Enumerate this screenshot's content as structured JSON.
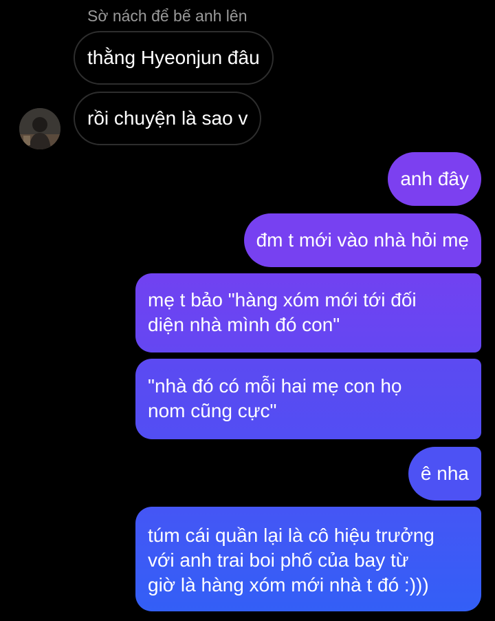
{
  "thread": {
    "sender_name": "Sờ nách để bế anh lên",
    "incoming": [
      "thằng Hyeonjun đâu",
      "rồi chuyện là sao v"
    ],
    "outgoing": [
      "anh đây",
      "đm t mới vào nhà hỏi mẹ",
      "mẹ t bảo \"hàng xóm mới tới đối\ndiện nhà mình đó con\"",
      "\"nhà đó có mỗi hai mẹ con họ\nnom cũng cực\"",
      "ê nha",
      "túm cái quần lại là cô hiệu trưởng\nvới anh trai boi phố của bay từ\ngiờ là hàng xóm mới nhà t đó :)))"
    ]
  },
  "avatar": {
    "icon": "profile-photo"
  },
  "colors": {
    "background": "#000000",
    "incoming_border": "#2e2e2e",
    "outgoing_top": "#7d3ff0",
    "outgoing_bottom": "#2f5ff6",
    "sender_name": "#9a9a9a"
  }
}
